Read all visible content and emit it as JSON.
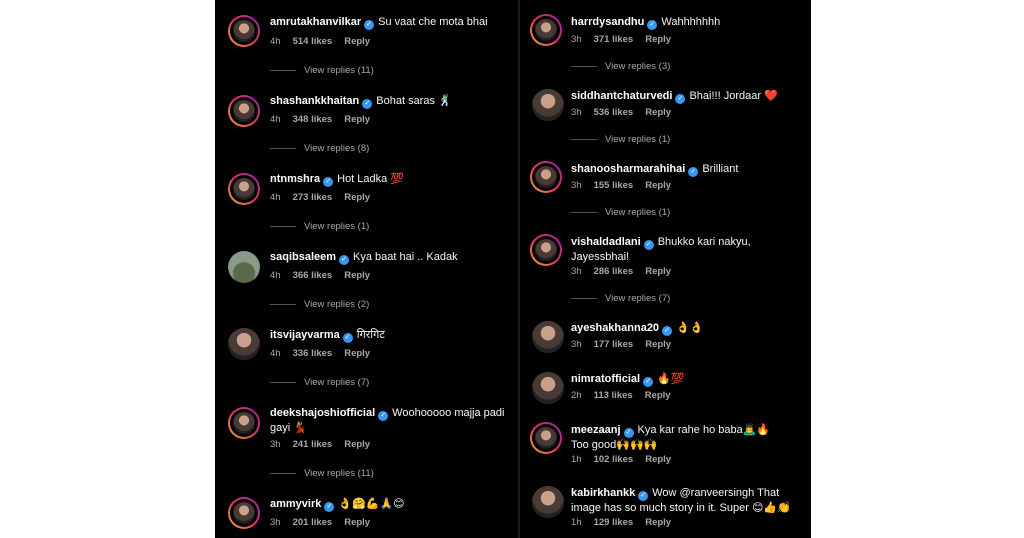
{
  "left_comments": [
    {
      "username": "amrutakhanvilkar",
      "text": "Su vaat che mota bhai",
      "time": "4h",
      "likes": "514 likes",
      "reply": "Reply",
      "view_replies": "View replies (11)"
    },
    {
      "username": "shashankkhaitan",
      "text": "Bohat saras 🕺",
      "time": "4h",
      "likes": "348 likes",
      "reply": "Reply",
      "view_replies": "View replies (8)"
    },
    {
      "username": "ntnmshra",
      "text": "Hot Ladka 💯",
      "time": "4h",
      "likes": "273 likes",
      "reply": "Reply",
      "view_replies": "View replies (1)"
    },
    {
      "username": "saqibsaleem",
      "text": "Kya baat hai .. Kadak",
      "time": "4h",
      "likes": "366 likes",
      "reply": "Reply",
      "view_replies": "View replies (2)"
    },
    {
      "username": "itsvijayvarma",
      "text": "गिरगिट",
      "time": "4h",
      "likes": "336 likes",
      "reply": "Reply",
      "view_replies": "View replies (7)"
    },
    {
      "username": "deekshajoshiofficial",
      "text": "Woohooooo majja padi gayi 💃",
      "time": "3h",
      "likes": "241 likes",
      "reply": "Reply",
      "view_replies": "View replies (11)"
    },
    {
      "username": "ammyvirk",
      "text": "👌🤗💪🙏😊",
      "time": "3h",
      "likes": "201 likes",
      "reply": "Reply",
      "view_replies": ""
    }
  ],
  "right_comments": [
    {
      "username": "harrdysandhu",
      "text": "Wahhhhhhh",
      "time": "3h",
      "likes": "371 likes",
      "reply": "Reply",
      "view_replies": "View replies (3)"
    },
    {
      "username": "siddhantchaturvedi",
      "text": "Bhai!!! Jordaar ❤️",
      "time": "3h",
      "likes": "536 likes",
      "reply": "Reply",
      "view_replies": "View replies (1)"
    },
    {
      "username": "shanoosharmarahihai",
      "text": "Brilliant",
      "time": "3h",
      "likes": "155 likes",
      "reply": "Reply",
      "view_replies": "View replies (1)"
    },
    {
      "username": "vishaldadlani",
      "text": "Bhukko kari nakyu, Jayessbhai!",
      "time": "3h",
      "likes": "286 likes",
      "reply": "Reply",
      "view_replies": "View replies (7)"
    },
    {
      "username": "ayeshakhanna20",
      "text": "👌👌",
      "time": "3h",
      "likes": "177 likes",
      "reply": "Reply",
      "view_replies": ""
    },
    {
      "username": "nimratofficial",
      "text": "🔥💯",
      "time": "2h",
      "likes": "113 likes",
      "reply": "Reply",
      "view_replies": ""
    },
    {
      "username": "meezaanj",
      "text": "Kya kar rahe ho baba🙇‍♂️🔥 Too good🙌🙌🙌",
      "time": "1h",
      "likes": "102 likes",
      "reply": "Reply",
      "view_replies": ""
    },
    {
      "username": "kabirkhankk",
      "text": "Wow @ranveersingh That image has so much story in it. Super 😊👍👏",
      "time": "1h",
      "likes": "129 likes",
      "reply": "Reply",
      "view_replies": ""
    }
  ],
  "colors": {
    "background": "#000000",
    "verified": "#3897f0",
    "meta": "#a8a8a8"
  },
  "icons": {
    "verified": "verified-badge-icon"
  }
}
